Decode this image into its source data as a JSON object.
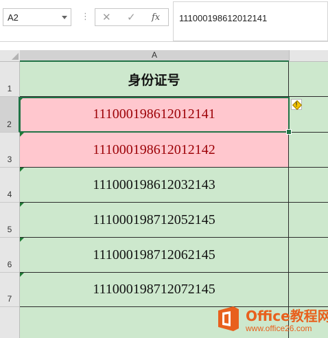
{
  "namebox": {
    "value": "A2"
  },
  "formula_bar": {
    "cancel_glyph": "✕",
    "enter_glyph": "✓",
    "fx_label": "fx",
    "value": "111000198612012141"
  },
  "columns": [
    "A"
  ],
  "rows": [
    {
      "num": "1",
      "value": "身份证号",
      "kind": "header"
    },
    {
      "num": "2",
      "value": "111000198612012141",
      "kind": "duplicate"
    },
    {
      "num": "3",
      "value": "111000198612012142",
      "kind": "duplicate"
    },
    {
      "num": "4",
      "value": "111000198612032143",
      "kind": "normal"
    },
    {
      "num": "5",
      "value": "111000198712052145",
      "kind": "normal"
    },
    {
      "num": "6",
      "value": "111000198712062145",
      "kind": "normal"
    },
    {
      "num": "7",
      "value": "111000198712072145",
      "kind": "normal"
    }
  ],
  "selected_cell": "A2",
  "colors": {
    "fill_green": "#cde8cd",
    "duplicate_fill": "#ffc7ce",
    "duplicate_text": "#9c0006",
    "selection": "#217346"
  },
  "watermark": {
    "line1": "Office教程网",
    "line2": "www.office26.com"
  }
}
